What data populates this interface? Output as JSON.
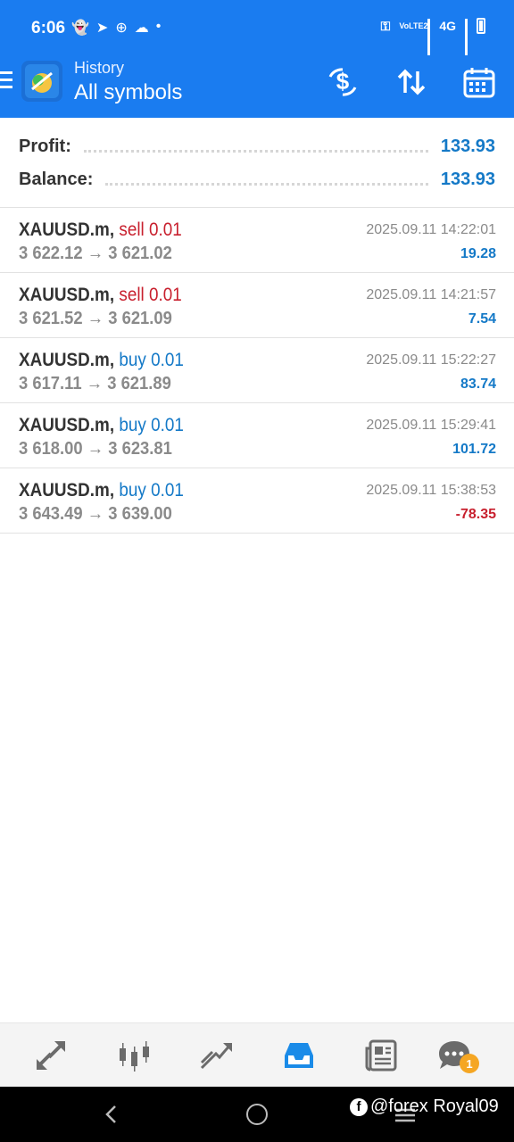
{
  "status_bar": {
    "time": "6:06",
    "network": "4G",
    "volte": "VoLTE2"
  },
  "toolbar": {
    "subtitle": "History",
    "title": "All symbols",
    "icons": [
      "deposit-currency-icon",
      "sort-icon",
      "calendar-icon"
    ]
  },
  "summary": {
    "profit_label": "Profit:",
    "profit_value": "133.93",
    "balance_label": "Balance:",
    "balance_value": "133.93"
  },
  "deals": [
    {
      "symbol": "XAUUSD.m,",
      "direction": "sell 0.01",
      "prices": "3 622.12 → 3 621.02",
      "time": "2025.09.11 14:22:01",
      "profit": "19.28"
    },
    {
      "symbol": "XAUUSD.m,",
      "direction": "sell 0.01",
      "prices": "3 621.52 → 3 621.09",
      "time": "2025.09.11 14:21:57",
      "profit": "7.54"
    },
    {
      "symbol": "XAUUSD.m,",
      "direction": "buy 0.01",
      "prices": "3 617.11 → 3 621.89",
      "time": "2025.09.11 15:22:27",
      "profit": "83.74"
    },
    {
      "symbol": "XAUUSD.m,",
      "direction": "buy 0.01",
      "prices": "3 618.00 → 3 623.81",
      "time": "2025.09.11 15:29:41",
      "profit": "101.72"
    },
    {
      "symbol": "XAUUSD.m,",
      "direction": "buy 0.01",
      "prices": "3 643.49 → 3 639.00",
      "time": "2025.09.11 15:38:53",
      "profit": "-78.35"
    }
  ],
  "bottom_nav": {
    "items": [
      "quotes-icon",
      "chart-icon",
      "trade-icon",
      "history-icon",
      "news-icon",
      "chat-icon"
    ],
    "active": "history-icon",
    "chat_badge": "1"
  },
  "watermark": {
    "text": "@forex Royal09"
  },
  "colors": {
    "accent": "#1a7cf0",
    "buy": "#1479c7",
    "sell": "#c8202e",
    "negative": "#c8202e"
  }
}
